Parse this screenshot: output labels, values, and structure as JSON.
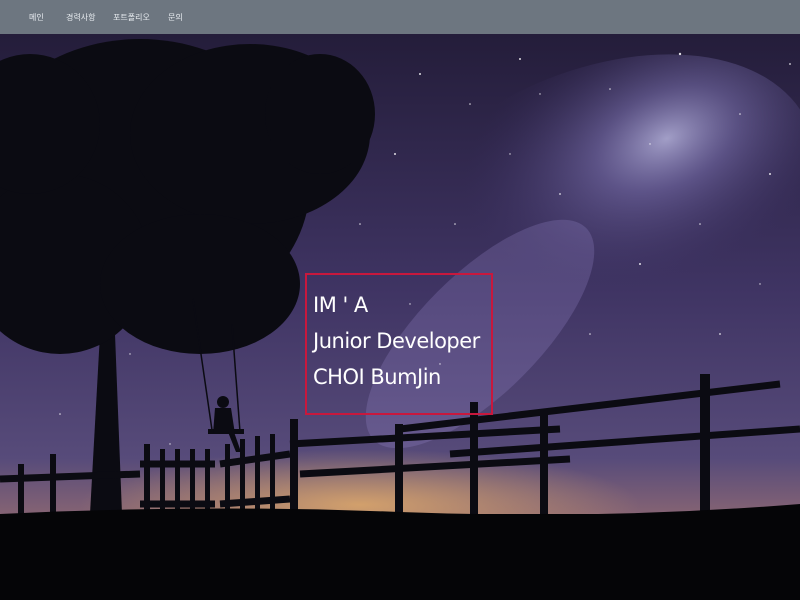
{
  "nav": {
    "items": [
      {
        "label": "메인"
      },
      {
        "label": "경력사항"
      },
      {
        "label": "포트폴리오"
      },
      {
        "label": "문의"
      }
    ],
    "bg_color": "#6d7680"
  },
  "hero": {
    "lines": [
      "IM ' A",
      "Junior Developer",
      "CHOI BumJin"
    ],
    "box_color": "#c8183d",
    "background": "night-sky-milky-way-tree-swing-fence"
  }
}
